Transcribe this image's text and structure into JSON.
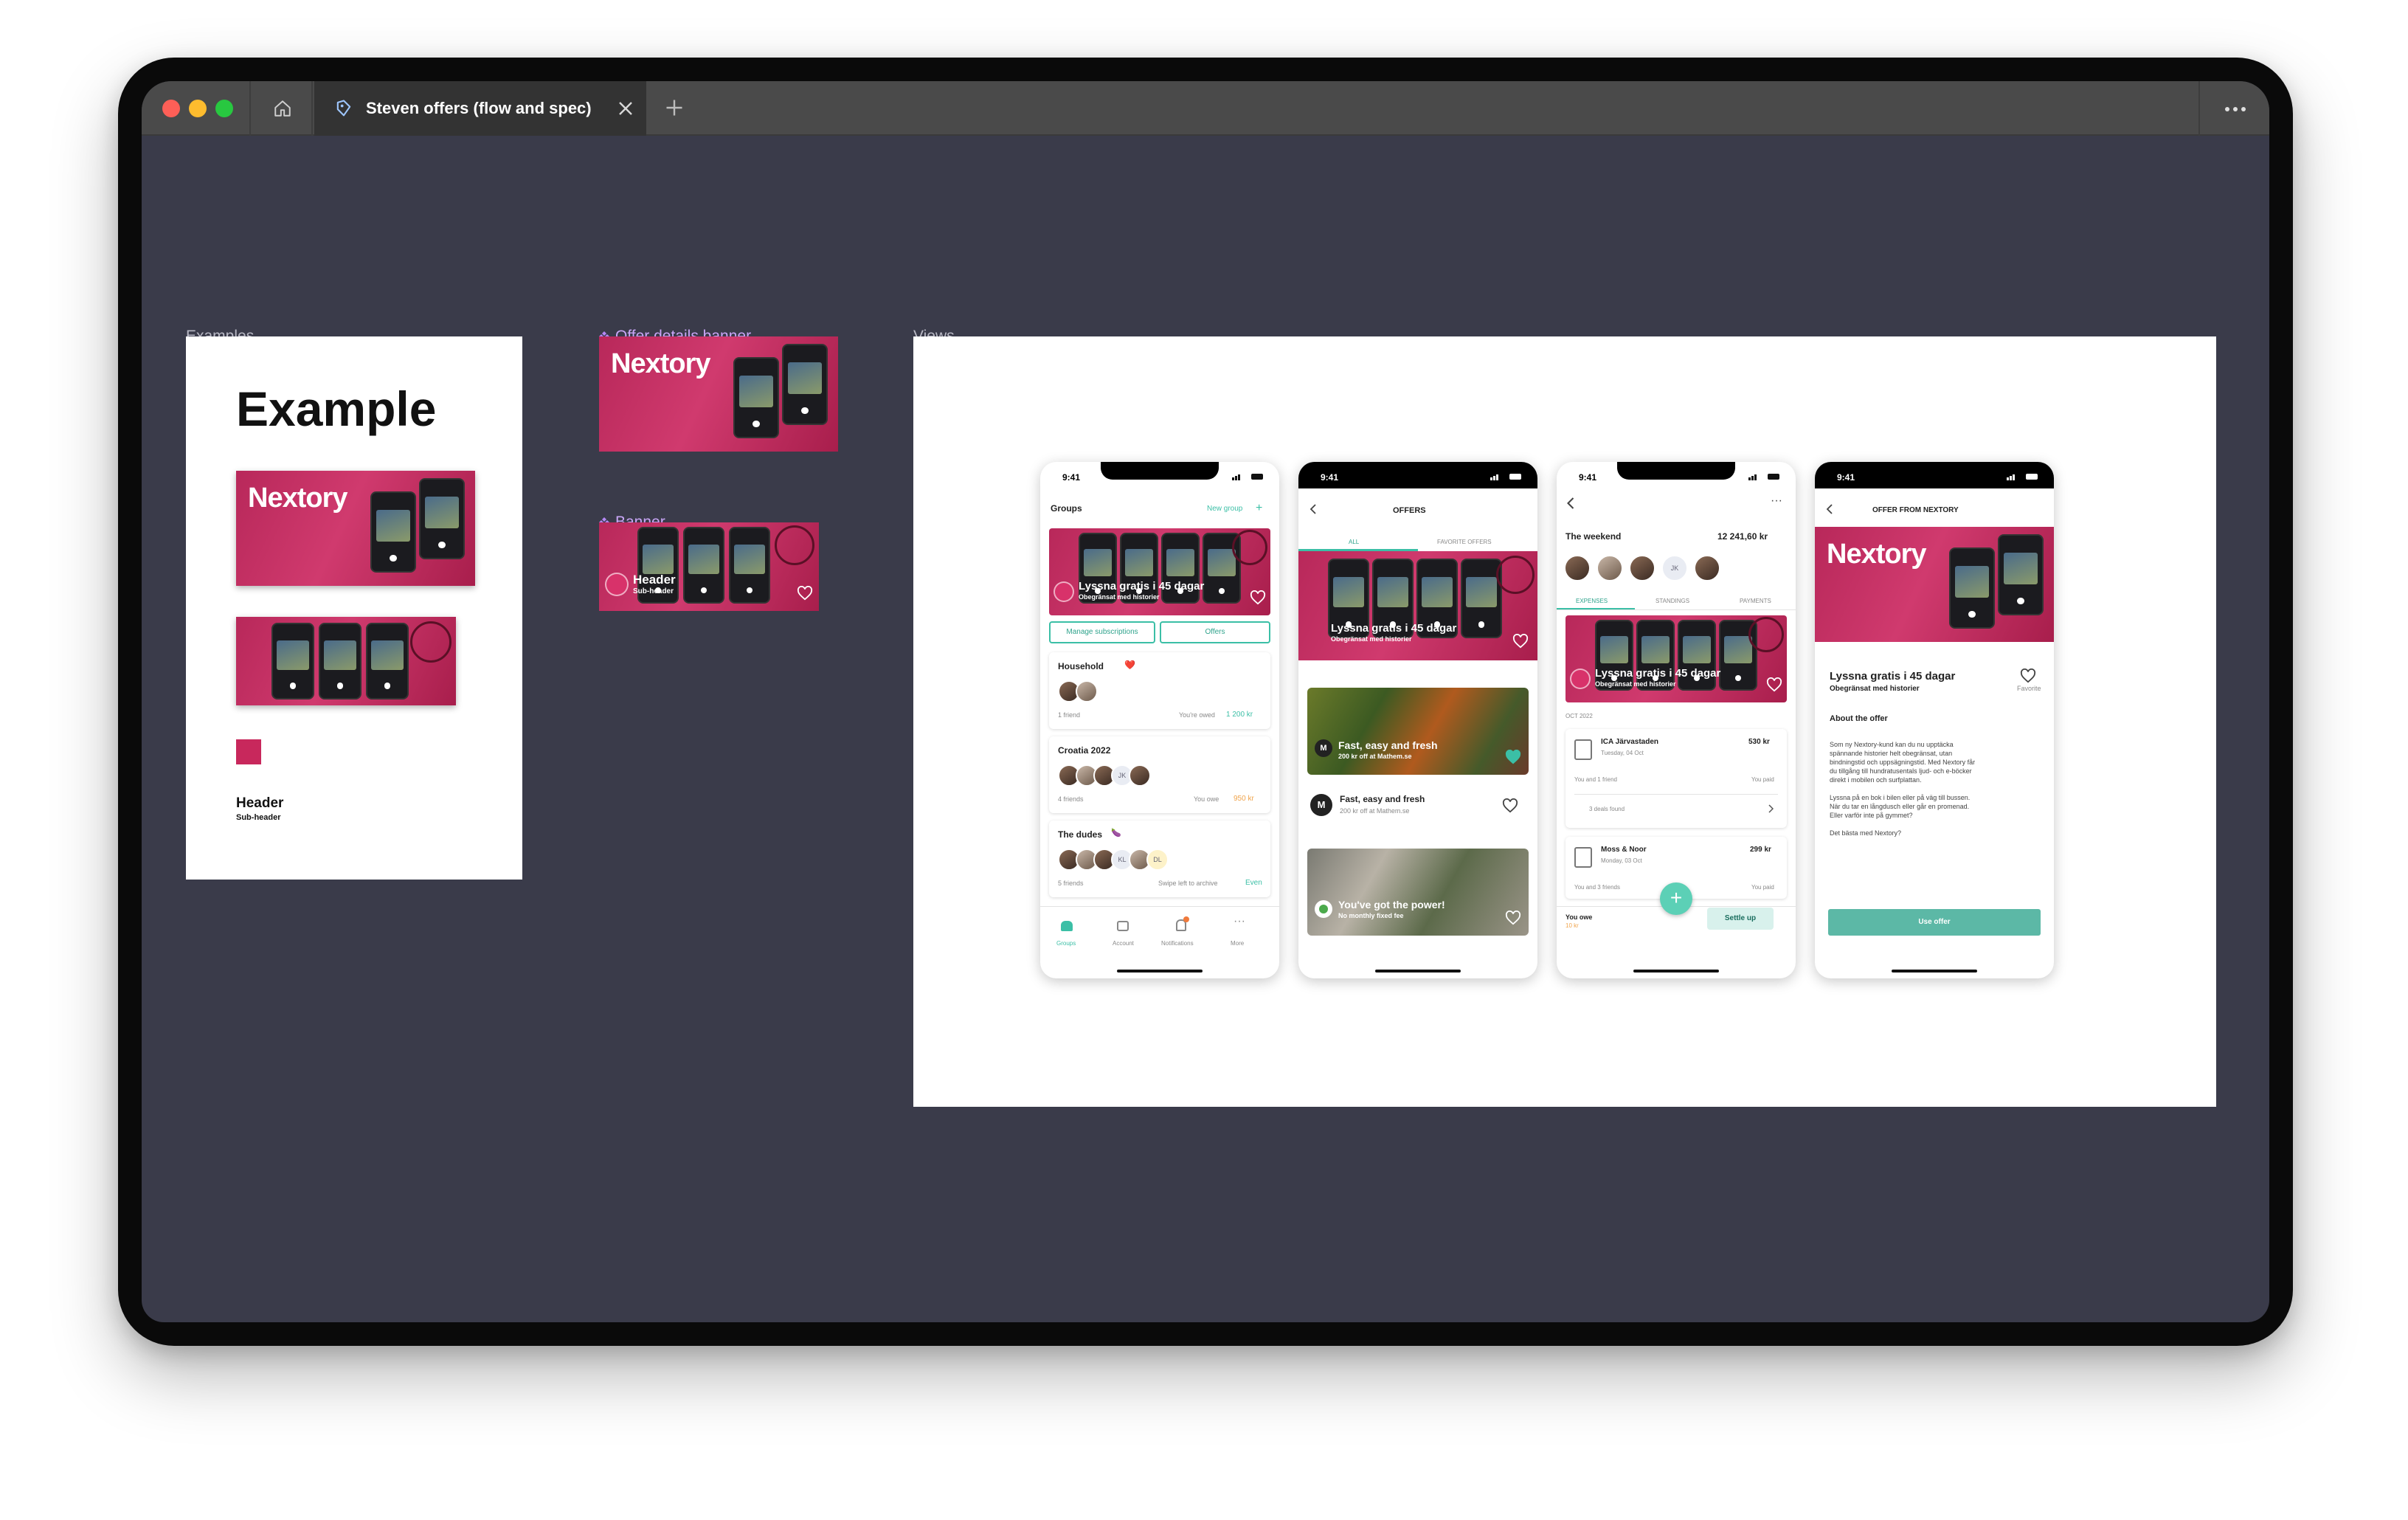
{
  "window": {
    "tab_title": "Steven offers (flow and spec)",
    "new_tab_symbol": "+"
  },
  "frames": {
    "examples_label": "Examples",
    "offer_details_banner_label": "Offer details banner",
    "banner_label": "Banner",
    "views_label": "Views"
  },
  "examples": {
    "heading": "Example",
    "brand": "Nextory",
    "header": "Header",
    "subheader": "Sub-header"
  },
  "offer_banner": {
    "brand": "Nextory"
  },
  "banner": {
    "header": "Header",
    "subheader": "Sub-header"
  },
  "phone1": {
    "time": "9:41",
    "title": "Groups",
    "new_group": "New group",
    "banner_title": "Lyssna gratis i 45 dagar",
    "banner_sub": "Obegränsat med historier",
    "btn_manage": "Manage subscriptions",
    "btn_offers": "Offers",
    "groups": [
      {
        "name": "Household",
        "emoji": "❤️",
        "meta": "1 friend",
        "status_label": "You're owed",
        "status_value": "1 200 kr"
      },
      {
        "name": "Croatia 2022",
        "emoji": "",
        "meta": "4 friends",
        "status_label": "You owe",
        "status_value": "950 kr"
      },
      {
        "name": "The dudes",
        "emoji": "🍆",
        "meta": "5 friends",
        "status_label": "Swipe left to archive",
        "status_value": "Even"
      }
    ],
    "initials_1": "JK",
    "initials_2": "KL",
    "initials_3": "DL",
    "nav": [
      "Groups",
      "Account",
      "Notifications",
      "More"
    ]
  },
  "phone2": {
    "time": "9:41",
    "title": "OFFERS",
    "tab_all": "ALL",
    "tab_fav": "FAVORITE OFFERS",
    "banner_title": "Lyssna gratis i 45 dagar",
    "banner_sub": "Obegränsat med historier",
    "offer1_title": "Fast, easy and fresh",
    "offer1_sub": "200 kr off at Mathem.se",
    "offer2_title": "Fast, easy and fresh",
    "offer2_sub": "200 kr off at Mathem.se",
    "offer3_title": "You've got the power!",
    "offer3_sub": "No monthly fixed fee"
  },
  "phone3": {
    "time": "9:41",
    "title": "The weekend",
    "total": "12 241,60 kr",
    "initials": "JK",
    "tabs": [
      "EXPENSES",
      "STANDINGS",
      "PAYMENTS"
    ],
    "banner_title": "Lyssna gratis i 45 dagar",
    "banner_sub": "Obegränsat med historier",
    "month": "OCT 2022",
    "exp1_name": "ICA Järvastaden",
    "exp1_date": "Tuesday, 04 Oct",
    "exp1_amount": "530 kr",
    "exp1_who": "You and 1 friend",
    "exp1_paid": "You paid",
    "deals": "3 deals found",
    "exp2_name": "Moss & Noor",
    "exp2_date": "Monday, 03 Oct",
    "exp2_amount": "299 kr",
    "exp2_who": "You and 3 friends",
    "exp2_paid": "You paid",
    "you_owe": "You owe",
    "you_owe_value": "10 kr",
    "settle": "Settle up"
  },
  "phone4": {
    "time": "9:41",
    "title": "OFFER FROM NEXTORY",
    "brand": "Nextory",
    "offer_title": "Lyssna gratis i 45 dagar",
    "offer_sub": "Obegränsat med historier",
    "favorite": "Favorite",
    "about": "About the offer",
    "para1_l1": "Som ny Nextory-kund kan du nu upptäcka",
    "para1_l2": "spännande historier helt obegränsat, utan",
    "para1_l3": "bindningstid och uppsägningstid. Med Nextory får",
    "para1_l4": "du tillgång till hundratusentals ljud- och e-böcker",
    "para1_l5": "direkt i mobilen och surfplattan.",
    "para2_l1": "Lyssna på en bok i bilen eller på väg till bussen.",
    "para2_l2": "När du tar en långdusch eller går en promenad.",
    "para2_l3": "Eller varför inte på gymmet?",
    "para3": "Det bästa med Nextory?",
    "cta": "Use offer"
  },
  "colors": {
    "accent": "#3bbfa6",
    "brand": "#c8285c",
    "canvas": "#3a3b4a"
  },
  "icons": [
    "home-icon",
    "figma-file-icon",
    "close-icon",
    "plus-icon",
    "more-icon",
    "component-diamond-icon",
    "heart-icon",
    "chevron-left-icon",
    "chevron-right-icon"
  ]
}
